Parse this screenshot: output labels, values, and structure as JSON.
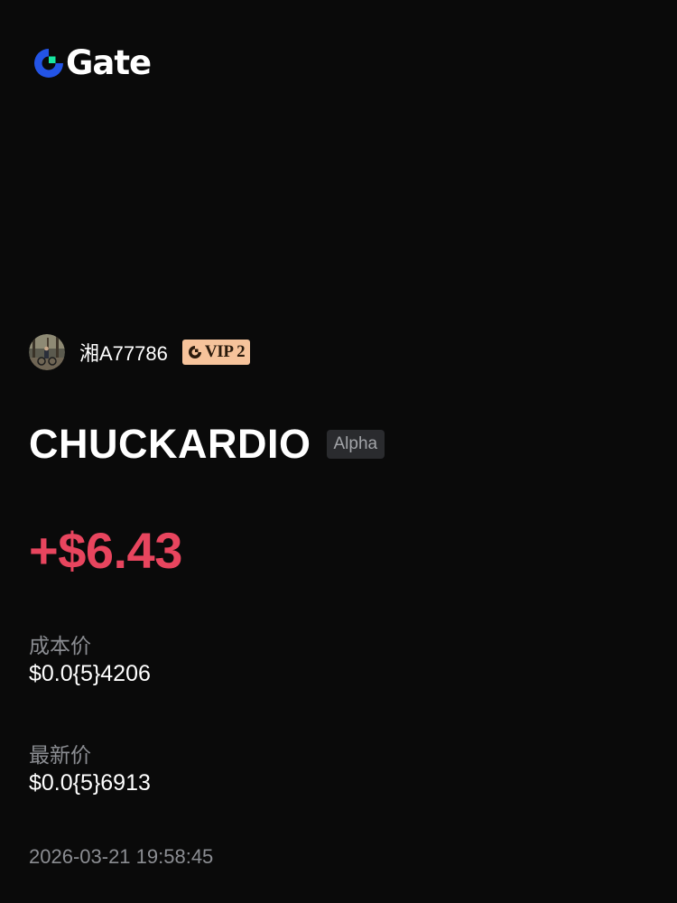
{
  "brand": {
    "name": "Gate",
    "logo_icon": "gate-logo-icon",
    "colors": {
      "blue": "#2354e6",
      "green": "#17e6a1"
    }
  },
  "user": {
    "name": "湘A77786",
    "vip_label": "VIP 2",
    "avatar_icon": "avatar"
  },
  "token": {
    "name": "CHUCKARDIO",
    "tag": "Alpha"
  },
  "pnl": {
    "value": "+$6.43",
    "color": "#e8455e"
  },
  "cost_price": {
    "label": "成本价",
    "value": "$0.0{5}4206"
  },
  "latest_price": {
    "label": "最新价",
    "value": "$0.0{5}6913"
  },
  "timestamp": "2026-03-21 19:58:45"
}
